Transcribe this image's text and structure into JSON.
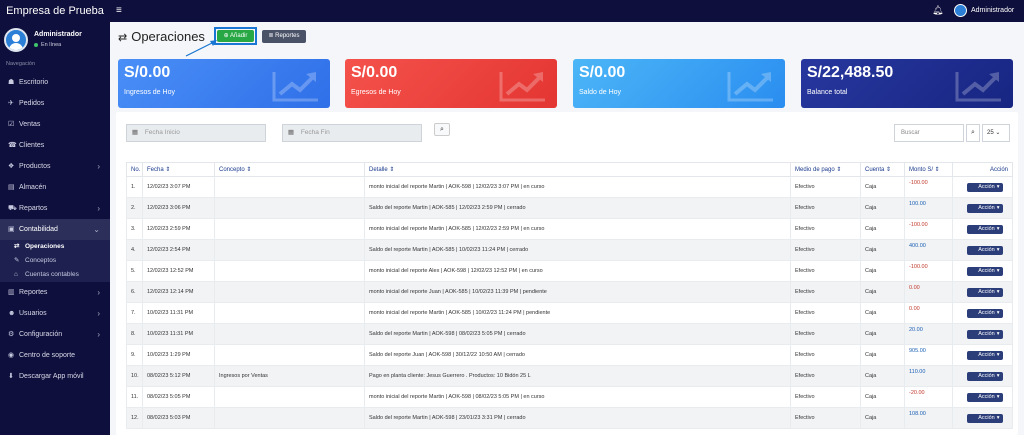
{
  "topbar": {
    "brand": "Empresa de Prueba",
    "menu_icon": "≡",
    "bell_icon": "bell-icon",
    "user": "Administrador"
  },
  "sidebar": {
    "user_name": "Administrador",
    "user_status": "En línea",
    "nav_header": "Navegación",
    "items": [
      {
        "label": "Escritorio",
        "icon": "☗"
      },
      {
        "label": "Pedidos",
        "icon": "✈"
      },
      {
        "label": "Ventas",
        "icon": "☑"
      },
      {
        "label": "Clientes",
        "icon": "☎"
      },
      {
        "label": "Productos",
        "icon": "❖"
      },
      {
        "label": "Almacén",
        "icon": "▤"
      },
      {
        "label": "Repartos",
        "icon": "⛟"
      },
      {
        "label": "Contabilidad",
        "icon": "▣"
      }
    ],
    "sub_items": [
      {
        "label": "Operaciones",
        "icon": "⇄"
      },
      {
        "label": "Conceptos",
        "icon": "✎"
      },
      {
        "label": "Cuentas contables",
        "icon": "⌂"
      }
    ],
    "items_after": [
      {
        "label": "Reportes",
        "icon": "▥"
      },
      {
        "label": "Usuarios",
        "icon": "☻"
      },
      {
        "label": "Configuración",
        "icon": "⚙"
      },
      {
        "label": "Centro de soporte",
        "icon": "◉"
      },
      {
        "label": "Descargar App móvil",
        "icon": "⬇"
      }
    ]
  },
  "header": {
    "title": "Operaciones",
    "add_label": "Añadir",
    "reports_label": "Reportes"
  },
  "cards": [
    {
      "amount": "S/0.00",
      "label": "Ingresos de Hoy",
      "color": "#3b7ff5"
    },
    {
      "amount": "S/0.00",
      "label": "Egresos de Hoy",
      "color": "#f0443f"
    },
    {
      "amount": "S/0.00",
      "label": "Saldo de Hoy",
      "color": "#3aa8f5"
    },
    {
      "amount": "S/22,488.50",
      "label": "Balance total",
      "color": "#1f2e8f"
    }
  ],
  "filters": {
    "start_placeholder": "Fecha Inicio",
    "end_placeholder": "Fecha Fin",
    "search_placeholder": "Buscar",
    "page_size": "25"
  },
  "table": {
    "headers": [
      "No.",
      "Fecha",
      "Concepto",
      "Detalle",
      "Medio de pago",
      "Cuenta",
      "Monto S/",
      "Acción"
    ],
    "action_label": "Acción",
    "rows": [
      [
        "1.",
        "12/02/23 3:07 PM",
        "",
        "monto inicial del reporte Martin | AOK-598 | 12/02/23 3:07 PM | en curso",
        "Efectivo",
        "Caja",
        "-100.00"
      ],
      [
        "2.",
        "12/02/23 3:06 PM",
        "",
        "Saldo del reporte Martin | AOK-585 | 12/02/23 2:59 PM | cerrado",
        "Efectivo",
        "Caja",
        "100.00"
      ],
      [
        "3.",
        "12/02/23 2:59 PM",
        "",
        "monto inicial del reporte Martin | AOK-585 | 12/02/23 2:59 PM | en curso",
        "Efectivo",
        "Caja",
        "-100.00"
      ],
      [
        "4.",
        "12/02/23 2:54 PM",
        "",
        "Saldo del reporte Martin | AOK-585 | 10/02/23 11:24 PM | cerrado",
        "Efectivo",
        "Caja",
        "400.00"
      ],
      [
        "5.",
        "12/02/23 12:52 PM",
        "",
        "monto inicial del reporte Alex | AOK-598 | 12/02/23 12:52 PM | en curso",
        "Efectivo",
        "Caja",
        "-100.00"
      ],
      [
        "6.",
        "12/02/23 12:14 PM",
        "",
        "monto inicial del reporte Juan | AOK-585 | 10/02/23 11:39 PM | pendiente",
        "Efectivo",
        "Caja",
        "0.00"
      ],
      [
        "7.",
        "10/02/23 11:31 PM",
        "",
        "monto inicial del reporte Martin | AOK-585 | 10/02/23 11:24 PM | pendiente",
        "Efectivo",
        "Caja",
        "0.00"
      ],
      [
        "8.",
        "10/02/23 11:31 PM",
        "",
        "Saldo del reporte Martin | AOK-598 | 08/02/23 5:05 PM | cerrado",
        "Efectivo",
        "Caja",
        "20.00"
      ],
      [
        "9.",
        "10/02/23 1:29 PM",
        "",
        "Saldo del reporte Juan | AOK-598 | 30/12/22 10:50 AM | cerrado",
        "Efectivo",
        "Caja",
        "905.00"
      ],
      [
        "10.",
        "08/02/23 5:12 PM",
        "Ingresos por Ventas",
        "Pago en planta cliente: Jesus Guerrero . Productos: 10 Bidón 25 L",
        "Efectivo",
        "Caja",
        "110.00"
      ],
      [
        "11.",
        "08/02/23 5:05 PM",
        "",
        "monto inicial del reporte Martin | AOK-598 | 08/02/23 5:05 PM | en curso",
        "Efectivo",
        "Caja",
        "-20.00"
      ],
      [
        "12.",
        "08/02/23 5:03 PM",
        "",
        "Saldo del reporte Martin | AOK-598 | 23/01/23 3:31 PM | cerrado",
        "Efectivo",
        "Caja",
        "108.00"
      ]
    ]
  }
}
